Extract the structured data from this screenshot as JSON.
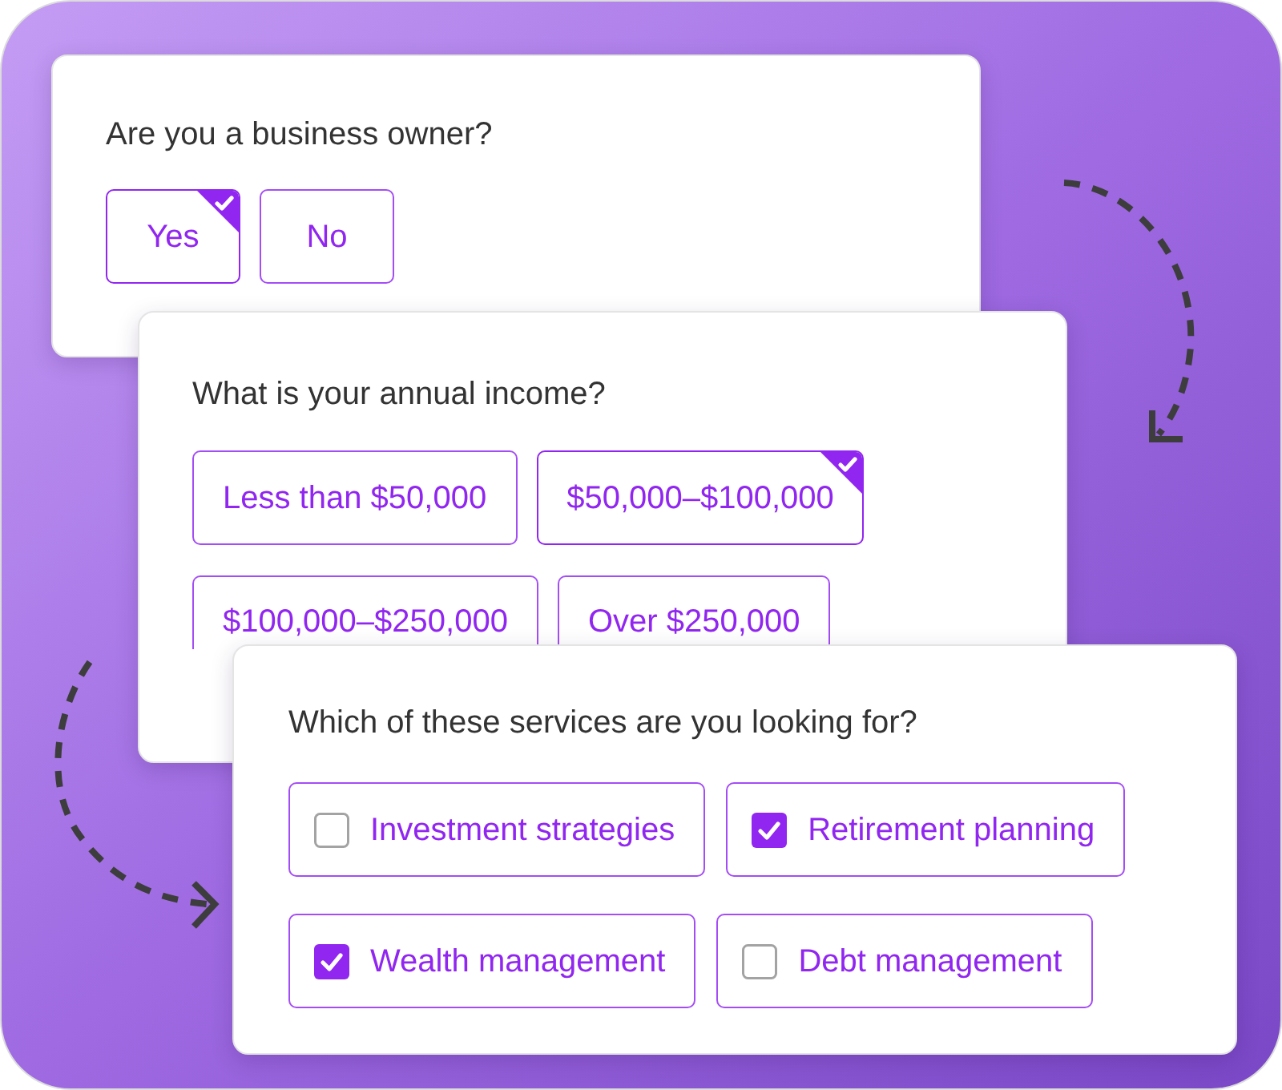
{
  "questions": [
    {
      "kind": "single",
      "text": "Are you a business owner?",
      "options": [
        {
          "label": "Yes",
          "selected": true
        },
        {
          "label": "No",
          "selected": false
        }
      ]
    },
    {
      "kind": "single",
      "text": "What is your annual income?",
      "options": [
        {
          "label": "Less than $50,000",
          "selected": false
        },
        {
          "label": "$50,000–$100,000",
          "selected": true
        },
        {
          "label": "$100,000–$250,000",
          "selected": false
        },
        {
          "label": "Over $250,000",
          "selected": false
        }
      ]
    },
    {
      "kind": "multi",
      "text": "Which of these services are you looking for?",
      "options": [
        {
          "label": "Investment strategies",
          "checked": false
        },
        {
          "label": "Retirement planning",
          "checked": true
        },
        {
          "label": "Wealth management",
          "checked": true
        },
        {
          "label": "Debt management",
          "checked": false
        }
      ]
    }
  ]
}
